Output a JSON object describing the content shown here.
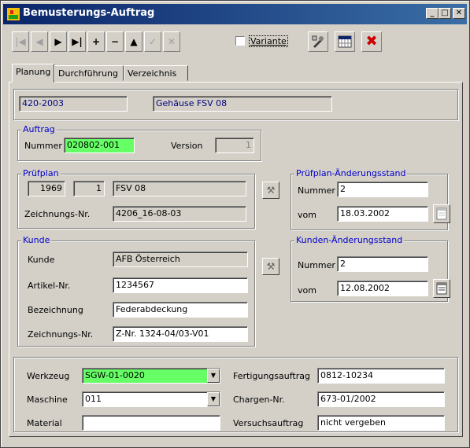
{
  "window": {
    "title": "Bemusterungs-Auftrag",
    "minimize": "_",
    "maximize": "□",
    "close": "✕"
  },
  "toolbar": {
    "variant_label": "Variante",
    "variant_checked": false,
    "buttons": [
      {
        "icon": "first-record-icon",
        "glyph": "|◀",
        "enabled": false
      },
      {
        "icon": "previous-record-icon",
        "glyph": "◀",
        "enabled": false
      },
      {
        "icon": "next-record-icon",
        "glyph": "▶",
        "enabled": true
      },
      {
        "icon": "last-record-icon",
        "glyph": "▶|",
        "enabled": true
      },
      {
        "icon": "add-record-icon",
        "glyph": "+",
        "enabled": true
      },
      {
        "icon": "delete-record-icon",
        "glyph": "−",
        "enabled": true
      },
      {
        "icon": "edit-record-icon",
        "glyph": "▲",
        "enabled": true
      },
      {
        "icon": "confirm-edit-icon",
        "glyph": "✓",
        "enabled": false
      },
      {
        "icon": "cancel-edit-icon",
        "glyph": "✕",
        "enabled": false
      }
    ]
  },
  "tabs": [
    "Planung",
    "Durchführung",
    "Verzeichnis"
  ],
  "header": {
    "order_id": "420-2003",
    "description": "Gehäuse FSV 08"
  },
  "auftrag": {
    "legend": "Auftrag",
    "nummer_label": "Nummer",
    "nummer": "020802-001",
    "version_label": "Version",
    "version": "1"
  },
  "pruefplan": {
    "legend": "Prüfplan",
    "id1": "1969",
    "id2": "1",
    "name": "FSV 08",
    "zeichnung_label": "Zeichnungs-Nr.",
    "zeichnung": "4206_16-08-03"
  },
  "pruefplan_aenderung": {
    "legend": "Prüfplan-Änderungsstand",
    "nummer_label": "Nummer",
    "nummer": "2",
    "vom_label": "vom",
    "vom": "18.03.2002"
  },
  "kunde": {
    "legend": "Kunde",
    "kunde_label": "Kunde",
    "kunde": "AFB Österreich",
    "artikel_label": "Artikel-Nr.",
    "artikel": "1234567",
    "bezeichnung_label": "Bezeichnung",
    "bezeichnung": "Federabdeckung",
    "zeichnung_label": "Zeichnungs-Nr.",
    "zeichnung": "Z-Nr. 1324-04/03-V01"
  },
  "kunden_aenderung": {
    "legend": "Kunden-Änderungsstand",
    "nummer_label": "Nummer",
    "nummer": "2",
    "vom_label": "vom",
    "vom": "12.08.2002"
  },
  "fertigung": {
    "werkzeug_label": "Werkzeug",
    "werkzeug": "SGW-01-0020",
    "maschine_label": "Maschine",
    "maschine": "011",
    "material_label": "Material",
    "material": "",
    "fertigungsauftrag_label": "Fertigungsauftrag",
    "fertigungsauftrag": "0812-10234",
    "chargen_label": "Chargen-Nr.",
    "chargen": "673-01/2002",
    "versuchsauftrag_label": "Versuchsauftrag",
    "versuchsauftrag": "nicht vergeben"
  },
  "colors": {
    "title_bar": "#0a246a",
    "highlight_field": "#66ff66",
    "group_label": "#0000cc",
    "delete_red": "#cc0000"
  }
}
